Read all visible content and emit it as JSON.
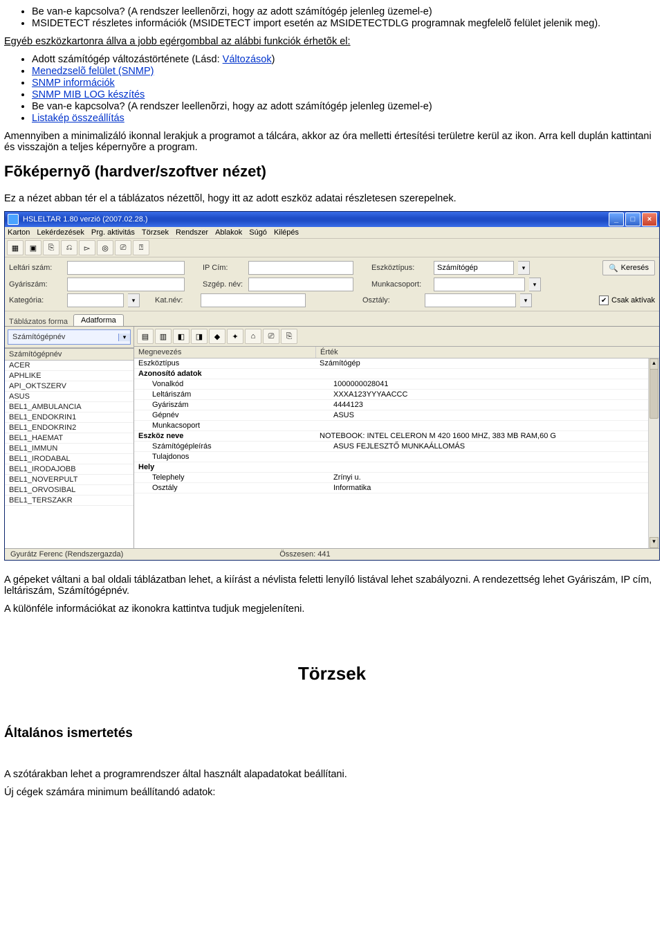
{
  "doc": {
    "list_top": {
      "li1": "Be van-e kapcsolva? (A rendszer leellenõrzi, hogy az adott számítógép jelenleg üzemel-e)",
      "li2": "MSIDETECT részletes információk (MSIDETECT import esetén az MSIDETECTDLG programnak megfelelõ felület jelenik meg)."
    },
    "intro_after": "Egyéb eszközkartonra állva a jobb egérgombbal az alábbi funkciók érhetõk el:",
    "list_after": {
      "li1_pre": "Adott számítógép változástörténete (Lásd: ",
      "li1_link": "Változások",
      "li1_post": ")",
      "li2_link": "Menedzselõ felület (SNMP)",
      "li3_link": "SNMP információk",
      "li4_link": "SNMP MIB LOG készítés",
      "li5": "Be van-e kapcsolva? (A rendszer leellenõrzi, hogy az adott számítógép jelenleg üzemel-e)",
      "li6_link": "Listakép összeállítás"
    },
    "para_tray": "Amennyiben a minimalizáló ikonnal lerakjuk a programot a tálcára, akkor az óra melletti értesítési területre kerül az ikon. Arra kell duplán kattintani és visszajön a teljes képernyõre a program.",
    "heading_main": "Fõképernyõ (hardver/szoftver nézet)",
    "para_view": "Ez a nézet abban tér el a táblázatos nézettõl, hogy itt az adott eszköz adatai részletesen szerepelnek.",
    "para_switch": "A gépeket váltani a bal oldali táblázatban lehet, a kiírást a névlista feletti lenyíló listával lehet szabályozni. A rendezettség lehet Gyáriszám, IP cím, leltáriszám, Számítógépnév.",
    "para_icons": "A különféle információkat az ikonokra kattintva tudjuk megjeleníteni.",
    "heading_torzsek": "Törzsek",
    "heading_altalanos": "Általános ismertetés",
    "para_szotar": "A szótárakban lehet a programrendszer által használt alapadatokat beállítani.",
    "para_ujceg": "Új cégek számára minimum beállítandó adatok:"
  },
  "app": {
    "title": "HSLELTAR 1.80 verzió (2007.02.28.)",
    "menus": {
      "m1": "Karton",
      "m2": "Lekérdezések",
      "m3": "Prg. aktivitás",
      "m4": "Törzsek",
      "m5": "Rendszer",
      "m6": "Ablakok",
      "m7": "Súgó",
      "m8": "Kilépés"
    },
    "filter": {
      "leltari_lbl": "Leltári szám:",
      "ip_lbl": "IP Cím:",
      "eszkoz_lbl": "Eszköztípus:",
      "eszkoz_val": "Számítógép",
      "search_btn": "Keresés",
      "gyariszam_lbl": "Gyáriszám:",
      "szgep_lbl": "Szgép. név:",
      "munka_lbl": "Munkacsoport:",
      "kat_lbl": "Kategória:",
      "katnev_lbl": "Kat.név:",
      "osztaly_lbl": "Osztály:",
      "csak_lbl": "Csak aktívak"
    },
    "tabs": {
      "label": "Táblázatos forma",
      "active": "Adatforma"
    },
    "leftpane": {
      "combo": "Számítógépnév",
      "colheader": "Számítógépnév",
      "rows": [
        "ACER",
        "APHLIKE",
        "API_OKTSZERV",
        "ASUS",
        "BEL1_AMBULANCIA",
        "BEL1_ENDOKRIN1",
        "BEL1_ENDOKRIN2",
        "BEL1_HAEMAT",
        "BEL1_IMMUN",
        "BEL1_IRODABAL",
        "BEL1_IRODAJOBB",
        "BEL1_NOVERPULT",
        "BEL1_ORVOSIBAL",
        "BEL1_TERSZAKR"
      ]
    },
    "gridheaders": {
      "c1": "Megnevezés",
      "c2": "Érték"
    },
    "gridrows": [
      {
        "k": "Eszköztípus",
        "v": "Számítógép",
        "bold": false,
        "indent": false
      },
      {
        "k": "Azonosító adatok",
        "v": "",
        "bold": true,
        "indent": false
      },
      {
        "k": "Vonalkód",
        "v": "1000000028041",
        "bold": false,
        "indent": true
      },
      {
        "k": "Leltáriszám",
        "v": "XXXA123YYYAACCC",
        "bold": false,
        "indent": true
      },
      {
        "k": "Gyáriszám",
        "v": "4444123",
        "bold": false,
        "indent": true
      },
      {
        "k": "Gépnév",
        "v": "ASUS",
        "bold": false,
        "indent": true
      },
      {
        "k": "Munkacsoport",
        "v": "",
        "bold": false,
        "indent": true
      },
      {
        "k": "Eszköz neve",
        "v": "NOTEBOOK: INTEL CELERON M 420 1600 MHZ, 383 MB RAM,60 G",
        "bold": true,
        "indent": false
      },
      {
        "k": "Számítógépleírás",
        "v": "ASUS FEJLESZTŐ MUNKAÁLLOMÁS",
        "bold": false,
        "indent": true
      },
      {
        "k": "Tulajdonos",
        "v": "",
        "bold": false,
        "indent": true
      },
      {
        "k": "Hely",
        "v": "",
        "bold": true,
        "indent": false
      },
      {
        "k": "Telephely",
        "v": "Zrínyi u.",
        "bold": false,
        "indent": true
      },
      {
        "k": "Osztály",
        "v": "Informatika",
        "bold": false,
        "indent": true
      }
    ],
    "status": {
      "left": "Gyurátz Ferenc (Rendszergazda)",
      "right": "Összesen: 441"
    }
  }
}
